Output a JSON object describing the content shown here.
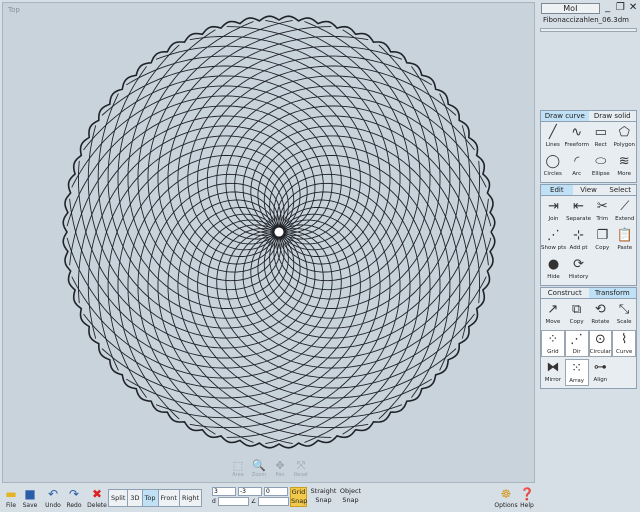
{
  "viewport": {
    "label": "Top",
    "pattern": {
      "curve_count": 34,
      "rings": 26,
      "color": "#1f2328"
    }
  },
  "navigation": [
    {
      "name": "zoom-window",
      "label": "Area",
      "glyph": "⬚"
    },
    {
      "name": "zoom",
      "label": "Zoom",
      "glyph": "🔍"
    },
    {
      "name": "pan",
      "label": "Pan",
      "glyph": "✥"
    },
    {
      "name": "reset",
      "label": "Reset",
      "glyph": "⤧"
    }
  ],
  "titlebar": {
    "app": "MoI",
    "filename": "Fibonaccizahlen_06.3dm",
    "minimize": "_",
    "restore": "❐",
    "close": "✕"
  },
  "draw_panel": {
    "tabs": [
      "Draw curve",
      "Draw solid"
    ],
    "active_tab": 0,
    "commands": [
      {
        "label": "Lines",
        "glyph": "╱"
      },
      {
        "label": "Freeform",
        "glyph": "∿"
      },
      {
        "label": "Rect",
        "glyph": "▭"
      },
      {
        "label": "Polygon",
        "glyph": "⬠"
      },
      {
        "label": "Circles",
        "glyph": "◯"
      },
      {
        "label": "Arc",
        "glyph": "◜"
      },
      {
        "label": "Ellipse",
        "glyph": "⬭"
      },
      {
        "label": "More",
        "glyph": "≋"
      }
    ]
  },
  "edit_panel": {
    "tabs": [
      "Edit",
      "View",
      "Select"
    ],
    "active_tab": 0,
    "commands": [
      {
        "label": "Join",
        "glyph": "⇥"
      },
      {
        "label": "Separate",
        "glyph": "⇤"
      },
      {
        "label": "Trim",
        "glyph": "✂"
      },
      {
        "label": "Extend",
        "glyph": "⟋"
      },
      {
        "label": "Show pts",
        "glyph": "⋰"
      },
      {
        "label": "Add pt",
        "glyph": "⊹"
      },
      {
        "label": "Copy",
        "glyph": "❐"
      },
      {
        "label": "Paste",
        "glyph": "📋"
      },
      {
        "label": "Hide",
        "glyph": "●"
      },
      {
        "label": "History",
        "glyph": "⟳"
      }
    ]
  },
  "transform_panel": {
    "tabs": [
      "Construct",
      "Transform"
    ],
    "active_tab": 1,
    "commands": [
      {
        "label": "Move",
        "glyph": "↗"
      },
      {
        "label": "Copy",
        "glyph": "⧉"
      },
      {
        "label": "Rotate",
        "glyph": "⟲"
      },
      {
        "label": "Scale",
        "glyph": "⤡"
      },
      {
        "label": "Grid",
        "glyph": "⁘",
        "boxed": true
      },
      {
        "label": "Dir",
        "glyph": "⋰",
        "boxed": true
      },
      {
        "label": "Circular",
        "glyph": "⊙",
        "boxed": true
      },
      {
        "label": "Curve",
        "glyph": "⌇",
        "boxed": true
      },
      {
        "label": "Mirror",
        "glyph": "⧓"
      },
      {
        "label": "Array",
        "glyph": "⁙",
        "boxed": true
      },
      {
        "label": "Align",
        "glyph": "⊶"
      }
    ]
  },
  "bottombar": {
    "file": "File",
    "save": "Save",
    "undo": "Undo",
    "redo": "Redo",
    "delete": "Delete",
    "views": [
      "Split",
      "3D",
      "Top",
      "Front",
      "Right"
    ],
    "active_view": "Top",
    "coords": {
      "x": "3",
      "y": "-3",
      "z": "0",
      "distance_symbol": "d",
      "angle_symbol": "∠"
    },
    "grid_snap": [
      "Grid",
      "Snap"
    ],
    "straight_snap": [
      "Straight",
      "Snap"
    ],
    "object_snap": [
      "Object",
      "Snap"
    ],
    "options": "Options",
    "help": "Help"
  },
  "colors": {
    "accent": "#bfe0f5",
    "snap_active": "#f2c94a"
  }
}
